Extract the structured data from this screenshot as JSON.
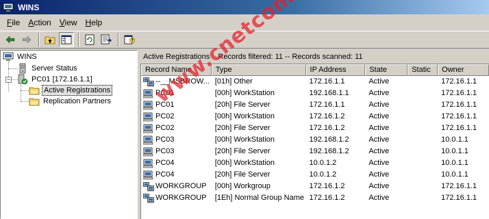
{
  "window": {
    "title": "WINS"
  },
  "menu": {
    "items": [
      {
        "pre": "",
        "u": "F",
        "post": "ile"
      },
      {
        "pre": "",
        "u": "A",
        "post": "ction"
      },
      {
        "pre": "",
        "u": "V",
        "post": "iew"
      },
      {
        "pre": "",
        "u": "H",
        "post": "elp"
      }
    ]
  },
  "tree": {
    "root": "WINS",
    "server_status": "Server Status",
    "server": "PC01 [172.16.1.1]",
    "active_registrations": "Active Registrations",
    "replication_partners": "Replication Partners"
  },
  "status_line": "Active Registrations    Records filtered: 11 -- Records scanned: 11",
  "table": {
    "columns": [
      "Record Name",
      "Type",
      "IP Address",
      "State",
      "Static",
      "Owner"
    ],
    "rows": [
      {
        "name": "--__MSBROW...",
        "type": "[01h] Other",
        "ip": "172.16.1.1",
        "state": "Active",
        "static": "",
        "owner": "172.16.1.1",
        "icon": "group"
      },
      {
        "name": "PC01",
        "type": "[00h] WorkStation",
        "ip": "192.168.1.1",
        "state": "Active",
        "static": "",
        "owner": "172.16.1.1",
        "icon": "computer"
      },
      {
        "name": "PC01",
        "type": "[20h] File Server",
        "ip": "172.16.1.1",
        "state": "Active",
        "static": "",
        "owner": "172.16.1.1",
        "icon": "computer"
      },
      {
        "name": "PC02",
        "type": "[00h] WorkStation",
        "ip": "172.16.1.2",
        "state": "Active",
        "static": "",
        "owner": "172.16.1.1",
        "icon": "computer"
      },
      {
        "name": "PC02",
        "type": "[20h] File Server",
        "ip": "172.16.1.2",
        "state": "Active",
        "static": "",
        "owner": "172.16.1.1",
        "icon": "computer"
      },
      {
        "name": "PC03",
        "type": "[00h] WorkStation",
        "ip": "192.168.1.2",
        "state": "Active",
        "static": "",
        "owner": "10.0.1.1",
        "icon": "computer"
      },
      {
        "name": "PC03",
        "type": "[20h] File Server",
        "ip": "192.168.1.2",
        "state": "Active",
        "static": "",
        "owner": "10.0.1.1",
        "icon": "computer"
      },
      {
        "name": "PC04",
        "type": "[00h] WorkStation",
        "ip": "10.0.1.2",
        "state": "Active",
        "static": "",
        "owner": "10.0.1.1",
        "icon": "computer"
      },
      {
        "name": "PC04",
        "type": "[20h] File Server",
        "ip": "10.0.1.2",
        "state": "Active",
        "static": "",
        "owner": "10.0.1.1",
        "icon": "computer"
      },
      {
        "name": "WORKGROUP",
        "type": "[00h] Workgroup",
        "ip": "172.16.1.2",
        "state": "Active",
        "static": "",
        "owner": "172.16.1.1",
        "icon": "group"
      },
      {
        "name": "WORKGROUP",
        "type": "[1Eh] Normal Group Name",
        "ip": "172.16.1.2",
        "state": "Active",
        "static": "",
        "owner": "172.16.1.1",
        "icon": "group"
      }
    ]
  },
  "watermark": "www.cnetcom.net",
  "colors": {
    "titlebar_start": "#0a246a",
    "face": "#d4d0c8",
    "watermark": "#e61e28"
  }
}
